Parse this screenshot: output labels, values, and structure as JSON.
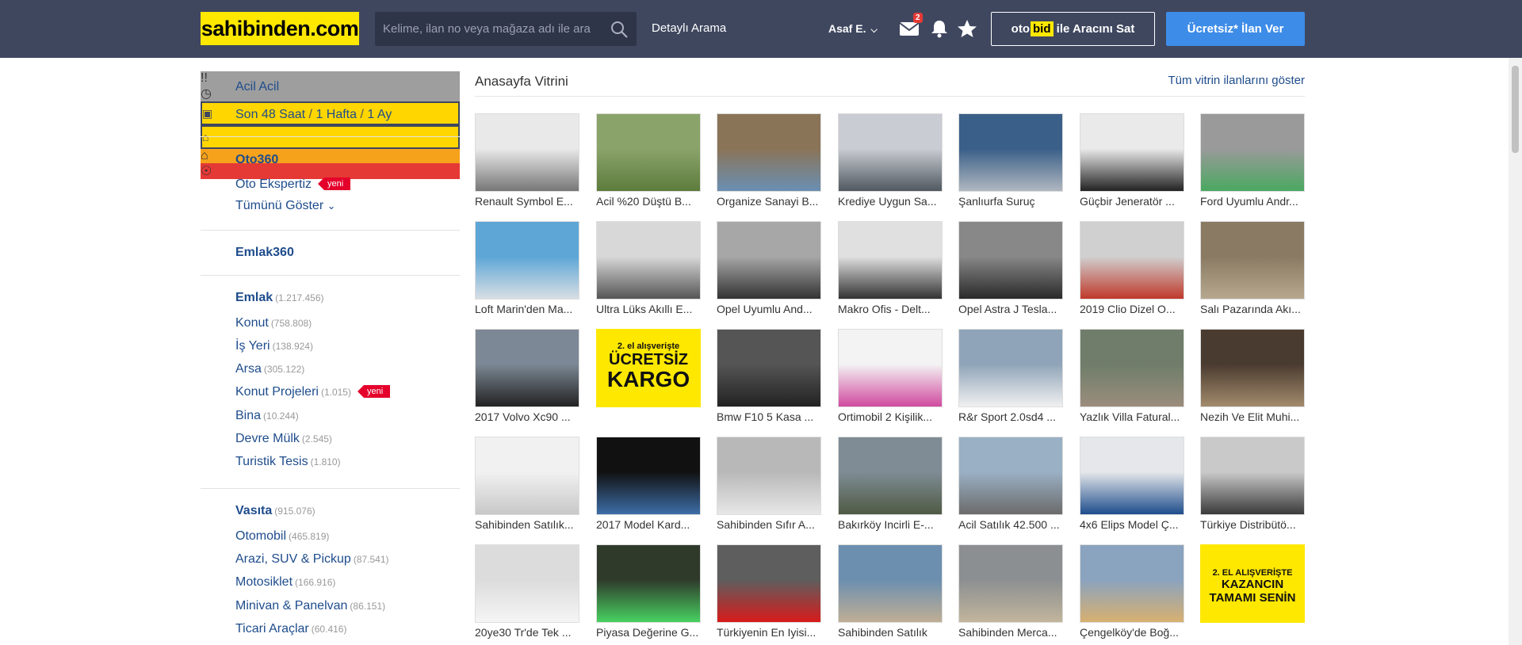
{
  "header": {
    "logo": "sahibinden.com",
    "search_placeholder": "Kelime, ilan no veya mağaza adı ile ara",
    "detayli": "Detaylı Arama",
    "user": "Asaf E.",
    "mail_badge": "2",
    "otobid_prefix": "oto",
    "otobid_bid": "bid",
    "otobid_suffix": " ile Aracını Sat",
    "ilan_ver": "Ücretsiz* İlan Ver"
  },
  "sidebar": {
    "acil": "Acil Acil",
    "son48": "Son 48 Saat",
    "hafta": "1 Hafta",
    "ay": "1 Ay",
    "sep": "/",
    "oto360": "Oto360",
    "oto_ekspertiz": "Oto Ekspertiz",
    "yeni": "yeni",
    "tumunu": "Tümünü Göster",
    "emlak360": "Emlak360",
    "emlak": {
      "label": "Emlak",
      "count": "(1.217.456)"
    },
    "emlak_items": [
      {
        "label": "Konut",
        "count": "(758.808)"
      },
      {
        "label": "İş Yeri",
        "count": "(138.924)"
      },
      {
        "label": "Arsa",
        "count": "(305.122)"
      },
      {
        "label": "Konut Projeleri",
        "count": "(1.015)"
      },
      {
        "label": "Bina",
        "count": "(10.244)"
      },
      {
        "label": "Devre Mülk",
        "count": "(2.545)"
      },
      {
        "label": "Turistik Tesis",
        "count": "(1.810)"
      }
    ],
    "vasita": {
      "label": "Vasıta",
      "count": "(915.076)"
    },
    "vasita_items": [
      {
        "label": "Otomobil",
        "count": "(465.819)"
      },
      {
        "label": "Arazi, SUV & Pickup",
        "count": "(87.541)"
      },
      {
        "label": "Motosiklet",
        "count": "(166.916)"
      },
      {
        "label": "Minivan & Panelvan",
        "count": "(86.151)"
      },
      {
        "label": "Ticari Araçlar",
        "count": "(60.416)"
      }
    ]
  },
  "vitrin": {
    "title": "Anasayfa Vitrini",
    "show_all": "Tüm vitrin ilanlarını göster",
    "items": [
      "Renault Symbol E...",
      "Acil %20 Düştü B...",
      "Organize Sanayi B...",
      "Krediye Uygun Sa...",
      "Şanlıurfa Suruç",
      "Güçbir Jeneratör ...",
      "Ford Uyumlu Andr...",
      "Loft Marin'den Ma...",
      "Ultra Lüks Akıllı E...",
      "Opel Uyumlu And...",
      "Makro Ofis - Delt...",
      "Opel Astra J Tesla...",
      "2019 Clio Dizel O...",
      "Salı Pazarında Akı...",
      "2017 Volvo Xc90 ...",
      "",
      "Bmw F10 5 Kasa ...",
      "Ortimobil 2 Kişilik...",
      "R&r Sport 2.0sd4 ...",
      "Yazlık Villa Fatural...",
      "Nezih Ve Elit Muhi...",
      "Sahibinden Satılık...",
      "2017 Model Kard...",
      "Sahibinden Sıfır A...",
      "Bakırköy Incirli E-...",
      "Acil Satılık 42.500 ...",
      "4x6 Elips Model Ç...",
      "Türkiye Distribütö...",
      "20ye30 Tr'de Tek ...",
      "Piyasa Değerine G...",
      "Türkiyenin En Iyisi...",
      "Sahibinden Satılık",
      "Sahibinden Merca...",
      "Çengelköy'de Boğ...",
      ""
    ],
    "promo1": {
      "line1": "2. el alışverişte",
      "line2": "ÜCRETSİZ",
      "line3": "KARGO"
    },
    "promo2": {
      "line1": "2. EL ALIŞVERİŞTE",
      "line2": "KAZANCIN",
      "line3": "TAMAMI SENİN"
    }
  }
}
